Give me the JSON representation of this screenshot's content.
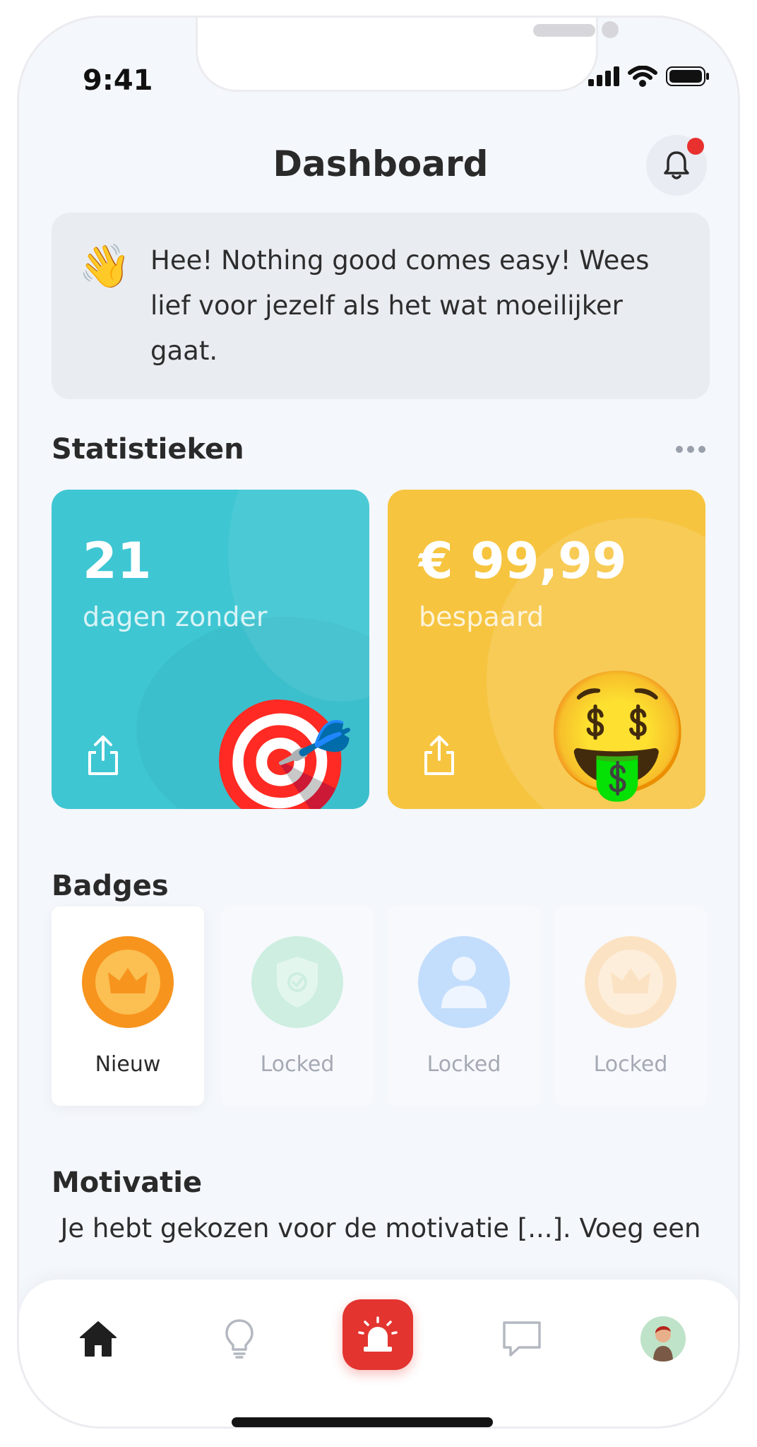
{
  "status": {
    "time": "9:41"
  },
  "header": {
    "title": "Dashboard"
  },
  "greeting": {
    "emoji": "👋",
    "text": "Hee! Nothing good comes easy! Wees lief voor jezelf als het wat moeilijker gaat."
  },
  "stats": {
    "title": "Statistieken",
    "cards": [
      {
        "value": "21",
        "label": "dagen zonder",
        "emoji": "🎯",
        "color": "#3ec6d3"
      },
      {
        "value": "€ 99,99",
        "label": "bespaard",
        "emoji": "🤑",
        "color": "#f6c43f"
      }
    ]
  },
  "badges": {
    "title": "Badges",
    "items": [
      {
        "label": "Nieuw",
        "icon": "crown-icon",
        "color": "#f7941d",
        "state": "active"
      },
      {
        "label": "Locked",
        "icon": "shield-icon",
        "color": "#cdeee0",
        "state": "locked"
      },
      {
        "label": "Locked",
        "icon": "user-icon",
        "color": "#c3ddfc",
        "state": "locked"
      },
      {
        "label": "Locked",
        "icon": "crown-icon",
        "color": "#fbe2c2",
        "state": "locked"
      }
    ]
  },
  "motivation": {
    "title": "Motivatie",
    "text": "Je hebt gekozen voor de motivatie [...]. Voeg een"
  },
  "tabbar": {
    "items": [
      "home-icon",
      "lightbulb-icon",
      "alarm-icon",
      "chat-icon",
      "profile-avatar"
    ],
    "accent": "#e3342f"
  }
}
